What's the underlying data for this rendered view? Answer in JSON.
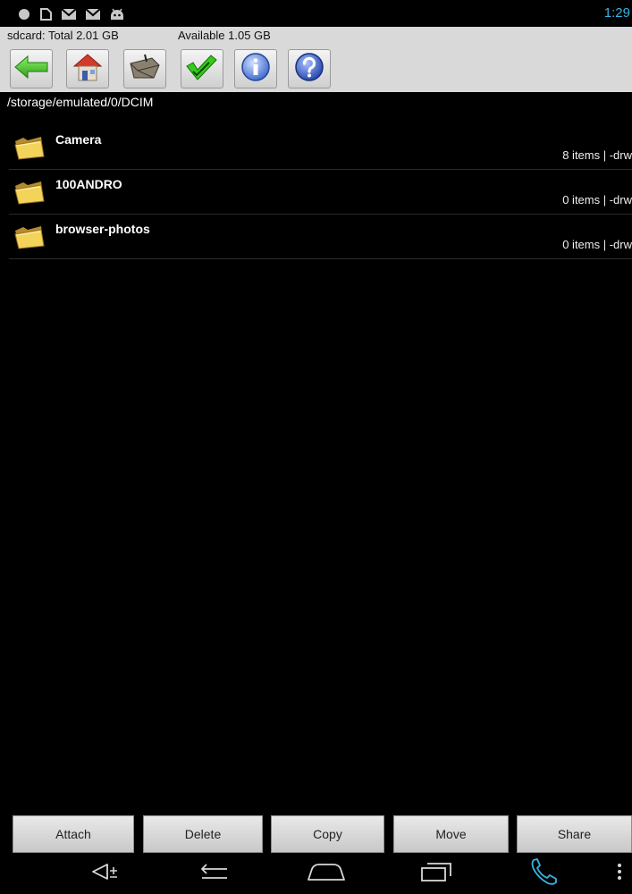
{
  "status_bar": {
    "icons": [
      "record-dot-icon",
      "screenshot-icon",
      "gmail-icon",
      "email-icon",
      "android-debug-icon"
    ],
    "time": "1:29",
    "time_color": "#33b5e5"
  },
  "storage": {
    "total": "sdcard: Total 2.01 GB",
    "available": "Available 1.05 GB"
  },
  "toolbar": {
    "buttons": [
      "back-arrow-icon",
      "home-icon",
      "multi-select-icon",
      "check-all-icon",
      "info-icon",
      "help-icon"
    ]
  },
  "path": "/storage/emulated/0/DCIM",
  "files": [
    {
      "name": "Camera",
      "meta": "8 items | -drw",
      "icon": "folder-icon"
    },
    {
      "name": "100ANDRO",
      "meta": "0 items | -drw",
      "icon": "folder-icon"
    },
    {
      "name": "browser-photos",
      "meta": "0 items | -drw",
      "icon": "folder-icon"
    }
  ],
  "actions": {
    "attach": "Attach",
    "delete": "Delete",
    "copy": "Copy",
    "move": "Move",
    "share": "Share"
  },
  "navbar": {
    "items": [
      "volume-icon",
      "back-icon",
      "home-icon",
      "recent-apps-icon",
      "phone-icon",
      "menu-icon"
    ],
    "phone_color": "#33b5e5"
  }
}
